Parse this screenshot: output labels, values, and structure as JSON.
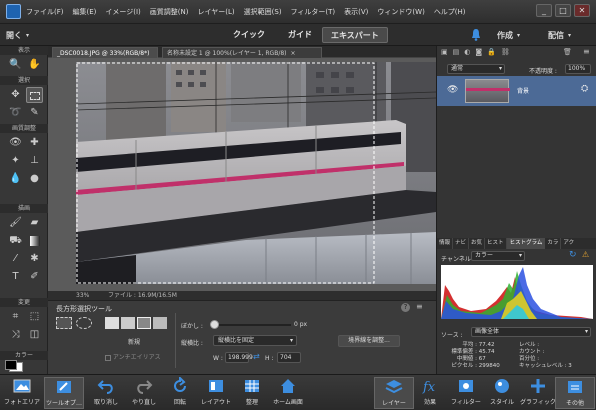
{
  "menubar": {
    "items": [
      "ファイル(F)",
      "編集(E)",
      "イメージ(I)",
      "画質調整(N)",
      "レイヤー(L)",
      "選択範囲(S)",
      "フィルター(T)",
      "表示(V)",
      "ウィンドウ(W)",
      "ヘルプ(H)"
    ],
    "window_buttons": [
      "_",
      "□",
      "✕"
    ]
  },
  "modebar": {
    "open_label": "開く",
    "tabs": [
      "クイック",
      "ガイド",
      "エキスパート"
    ],
    "active_tab": "エキスパート",
    "create_label": "作成",
    "share_label": "配信"
  },
  "toolbox": {
    "section_labels": [
      "表示",
      "選択",
      "画質調整",
      "描画",
      "変更",
      "カラー"
    ]
  },
  "document_tabs": [
    {
      "label": "_DSC0018.JPG @ 33%(RGB/8*)",
      "close": "×"
    },
    {
      "label": "名称未設定 1 @ 100%(レイヤー 1, RGB/8)",
      "close": "×"
    }
  ],
  "status": {
    "zoom": "33%",
    "doc_info": "ファイル : 16.9M/16.5M"
  },
  "options_bar": {
    "tool_name": "長方形選択ツール",
    "new_label": "新規",
    "antialias_label": "アンチエイリアス",
    "feather_label": "ぼかし :",
    "feather_value": "0 px",
    "aspect_label": "縦横比 :",
    "aspect_value": "縦横比を固定",
    "width_label": "W :",
    "width_value": "198.999",
    "height_label": "H :",
    "height_value": "704",
    "refine_button": "境界線を調整..."
  },
  "layers_panel": {
    "blend_mode": "通常",
    "opacity_label": "不透明度 :",
    "opacity_value": "100%",
    "layer_name": "背景"
  },
  "histogram_panel": {
    "tabs": [
      "情報",
      "ナビ",
      "お気",
      "ヒスト",
      "ヒストグラム",
      "カラ",
      "アク"
    ],
    "active_tab": "ヒストグラム",
    "channel_label": "チャンネル :",
    "channel_value": "カラー",
    "source_label": "ソース :",
    "source_value": "画像全体",
    "stats_left": [
      [
        "平均 :",
        "77.42"
      ],
      [
        "標準偏差 :",
        "45.74"
      ],
      [
        "中間値 :",
        "67"
      ],
      [
        "ピクセル :",
        "299840"
      ]
    ],
    "stats_right": [
      "レベル :",
      "カウント :",
      "百分位 :",
      "キャッシュレベル :",
      "3"
    ]
  },
  "bottombar": {
    "items": [
      "フォトエリア",
      "ツールオプ…",
      "取り消し",
      "やり直し",
      "回転",
      "レイアウト",
      "整理",
      "ホーム画面",
      "レイヤー",
      "効果",
      "フィルター",
      "スタイル",
      "グラフィック",
      "その他"
    ]
  },
  "colors": {
    "accent": "#3d8ee0",
    "panel": "#343434",
    "train_stripe": "#c0306a"
  }
}
